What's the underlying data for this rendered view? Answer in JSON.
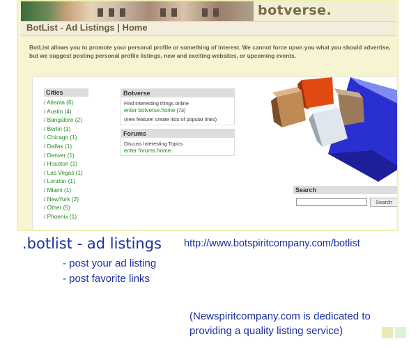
{
  "header": {
    "logo_text": "botverse.",
    "page_title": "BotList - Ad Listings | Home"
  },
  "intro_text": "BotList allows you to promote your personal profile or something of interest. We cannot force upon you what you should advertise, but we suggest posting personal profile listings, new and exciting websites, or upcoming events.",
  "cities": {
    "heading": "Cities",
    "items": [
      "/ Atlanta (6)",
      "/ Austin (4)",
      "/ Bangalore (2)",
      "/ Berlin (1)",
      "/ Chicago (1)",
      "/ Dallas (1)",
      "/ Denver (1)",
      "/ Houston (1)",
      "/ Las Vegas (1)",
      "/ London (1)",
      "/ Miami (1)",
      "/ NewYork (2)",
      "/ Other (5)",
      "/ Phoenix (1)"
    ]
  },
  "botverse_panel": {
    "heading": "Botverse",
    "desc": "Find interesting things online",
    "link": "enter botverse.home",
    "count": "(73)",
    "note": "(new feature! create lists of popular links)"
  },
  "forums_panel": {
    "heading": "Forums",
    "desc": "Discuss Interesting Topics",
    "link": "enter forums.home"
  },
  "search": {
    "heading": "Search",
    "button_label": "Search",
    "value": ""
  },
  "slide": {
    "title": ".botlist - ad listings",
    "url": "http://www.botspiritcompany.com/botlist",
    "bullets": [
      "- post your ad listing",
      "- post favorite links"
    ],
    "note_line1": "(Newspiritcompany.com is dedicated to",
    "note_line2": "providing a quality listing service)"
  },
  "colors": {
    "slide_text": "#1b2fa0",
    "link_green": "#1f8a1f",
    "header_brown": "#6b5b43",
    "frame_yellow": "#f0f0b0"
  }
}
